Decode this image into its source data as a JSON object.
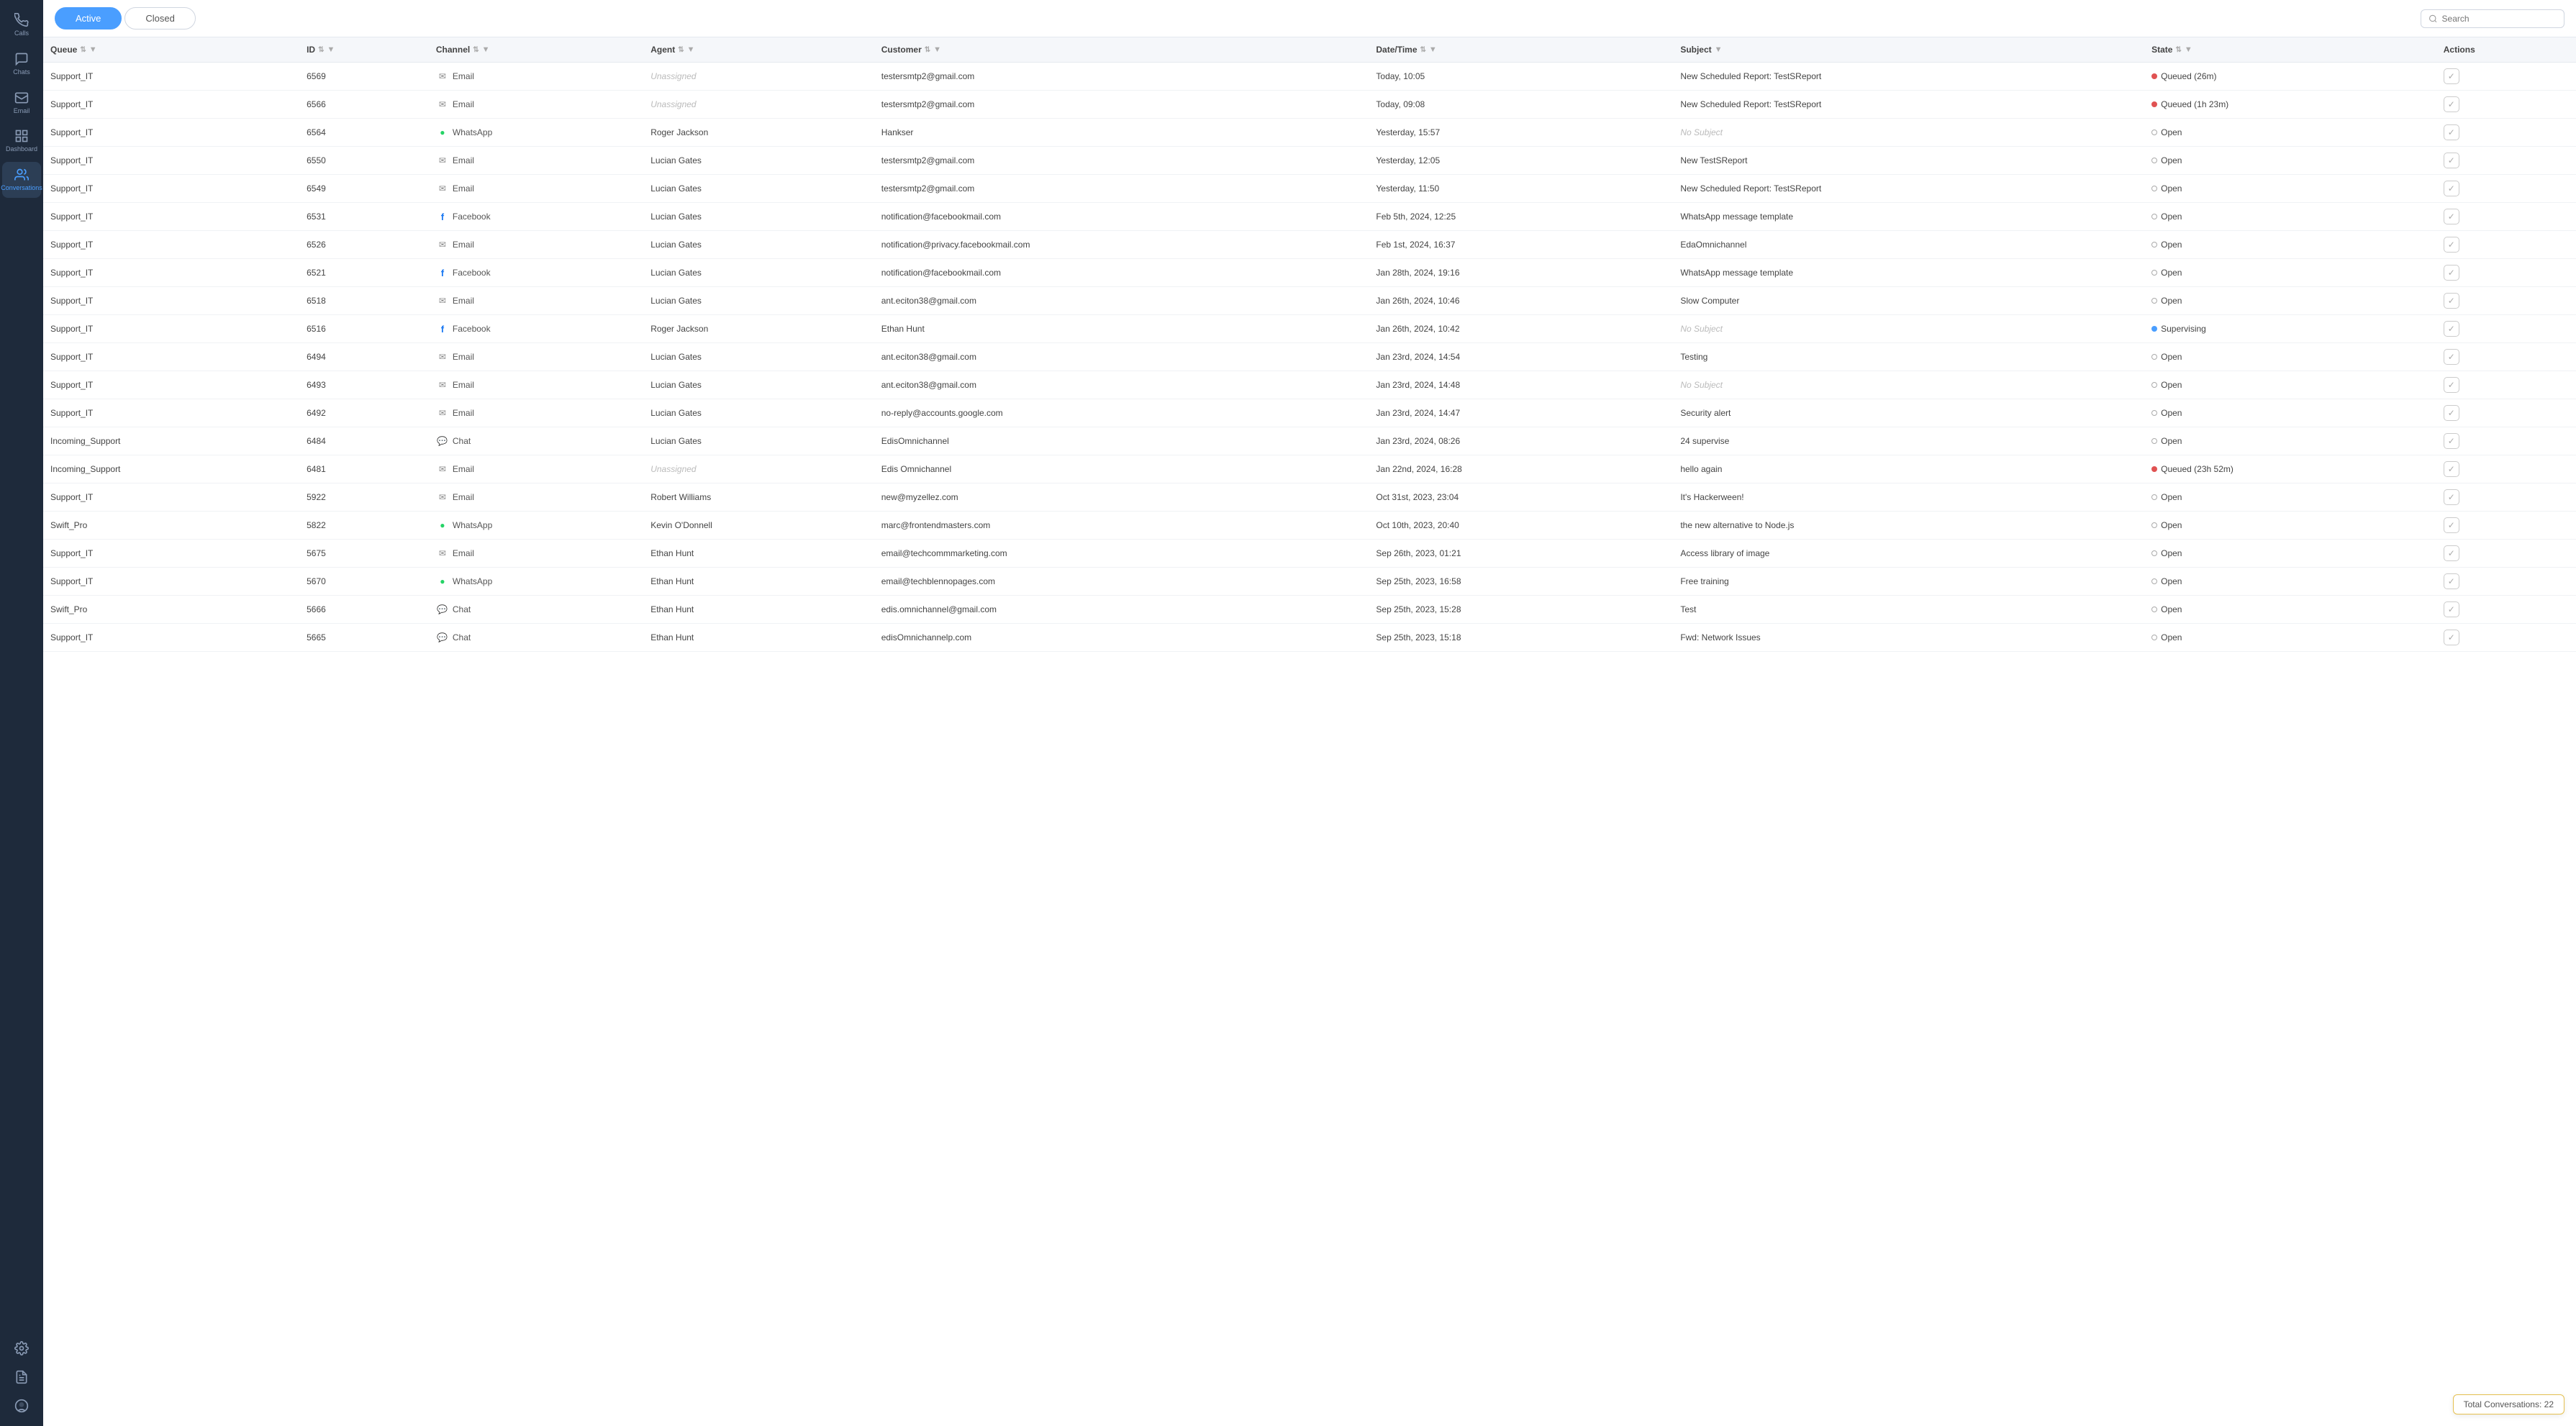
{
  "sidebar": {
    "items": [
      {
        "name": "calls",
        "label": "Calls",
        "icon": "phone"
      },
      {
        "name": "chats",
        "label": "Chats",
        "icon": "chat",
        "active": false
      },
      {
        "name": "email",
        "label": "Email",
        "icon": "mail"
      },
      {
        "name": "dashboard",
        "label": "Dashboard",
        "icon": "grid"
      },
      {
        "name": "conversations",
        "label": "Conversations",
        "icon": "people",
        "active": true
      }
    ],
    "bottom": [
      {
        "name": "settings",
        "label": "",
        "icon": "gear"
      },
      {
        "name": "reports",
        "label": "",
        "icon": "report"
      },
      {
        "name": "profile",
        "label": "",
        "icon": "user-circle"
      }
    ]
  },
  "tabs": {
    "active_label": "Active",
    "closed_label": "Closed"
  },
  "search": {
    "placeholder": "Search"
  },
  "table": {
    "columns": [
      {
        "key": "queue",
        "label": "Queue"
      },
      {
        "key": "id",
        "label": "ID"
      },
      {
        "key": "channel",
        "label": "Channel"
      },
      {
        "key": "agent",
        "label": "Agent"
      },
      {
        "key": "customer",
        "label": "Customer"
      },
      {
        "key": "datetime",
        "label": "Date/Time"
      },
      {
        "key": "subject",
        "label": "Subject"
      },
      {
        "key": "state",
        "label": "State"
      },
      {
        "key": "actions",
        "label": "Actions"
      }
    ],
    "rows": [
      {
        "queue": "Support_IT",
        "id": "6569",
        "channel": "Email",
        "channel_type": "email",
        "agent": "Unassigned",
        "agent_type": "unassigned",
        "customer": "testersmtp2@gmail.com",
        "datetime": "Today, 10:05",
        "subject": "New Scheduled Report: TestSReport",
        "state": "Queued (26m)",
        "state_type": "queued"
      },
      {
        "queue": "Support_IT",
        "id": "6566",
        "channel": "Email",
        "channel_type": "email",
        "agent": "Unassigned",
        "agent_type": "unassigned",
        "customer": "testersmtp2@gmail.com",
        "datetime": "Today, 09:08",
        "subject": "New Scheduled Report: TestSReport",
        "state": "Queued (1h 23m)",
        "state_type": "queued"
      },
      {
        "queue": "Support_IT",
        "id": "6564",
        "channel": "WhatsApp",
        "channel_type": "whatsapp",
        "agent": "Roger Jackson",
        "agent_type": "assigned",
        "customer": "Hankser",
        "datetime": "Yesterday, 15:57",
        "subject": "No Subject",
        "subject_type": "none",
        "state": "Open",
        "state_type": "open"
      },
      {
        "queue": "Support_IT",
        "id": "6550",
        "channel": "Email",
        "channel_type": "email",
        "agent": "Lucian Gates",
        "agent_type": "assigned",
        "customer": "testersmtp2@gmail.com",
        "datetime": "Yesterday, 12:05",
        "subject": "New  TestSReport",
        "state": "Open",
        "state_type": "open"
      },
      {
        "queue": "Support_IT",
        "id": "6549",
        "channel": "Email",
        "channel_type": "email",
        "agent": "Lucian Gates",
        "agent_type": "assigned",
        "customer": "testersmtp2@gmail.com",
        "datetime": "Yesterday, 11:50",
        "subject": "New Scheduled Report: TestSReport",
        "state": "Open",
        "state_type": "open"
      },
      {
        "queue": "Support_IT",
        "id": "6531",
        "channel": "Facebook",
        "channel_type": "facebook",
        "agent": "Lucian Gates",
        "agent_type": "assigned",
        "customer": "notification@facebookmail.com",
        "datetime": "Feb 5th, 2024, 12:25",
        "subject": "WhatsApp message template",
        "state": "Open",
        "state_type": "open"
      },
      {
        "queue": "Support_IT",
        "id": "6526",
        "channel": "Email",
        "channel_type": "email",
        "agent": "Lucian Gates",
        "agent_type": "assigned",
        "customer": "notification@privacy.facebookmail.com",
        "datetime": "Feb 1st, 2024, 16:37",
        "subject": "EdaOmnichannel",
        "state": "Open",
        "state_type": "open"
      },
      {
        "queue": "Support_IT",
        "id": "6521",
        "channel": "Facebook",
        "channel_type": "facebook",
        "agent": "Lucian Gates",
        "agent_type": "assigned",
        "customer": "notification@facebookmail.com",
        "datetime": "Jan 28th, 2024, 19:16",
        "subject": "WhatsApp message template",
        "state": "Open",
        "state_type": "open"
      },
      {
        "queue": "Support_IT",
        "id": "6518",
        "channel": "Email",
        "channel_type": "email",
        "agent": "Lucian Gates",
        "agent_type": "assigned",
        "customer": "ant.eciton38@gmail.com",
        "datetime": "Jan 26th, 2024, 10:46",
        "subject": "Slow Computer",
        "state": "Open",
        "state_type": "open"
      },
      {
        "queue": "Support_IT",
        "id": "6516",
        "channel": "Facebook",
        "channel_type": "facebook",
        "agent": "Roger Jackson",
        "agent_type": "assigned",
        "customer": "Ethan Hunt",
        "datetime": "Jan 26th, 2024, 10:42",
        "subject": "No Subject",
        "subject_type": "none",
        "state": "Supervising",
        "state_type": "supervising"
      },
      {
        "queue": "Support_IT",
        "id": "6494",
        "channel": "Email",
        "channel_type": "email",
        "agent": "Lucian Gates",
        "agent_type": "assigned",
        "customer": "ant.eciton38@gmail.com",
        "datetime": "Jan 23rd, 2024, 14:54",
        "subject": "Testing",
        "state": "Open",
        "state_type": "open"
      },
      {
        "queue": "Support_IT",
        "id": "6493",
        "channel": "Email",
        "channel_type": "email",
        "agent": "Lucian Gates",
        "agent_type": "assigned",
        "customer": "ant.eciton38@gmail.com",
        "datetime": "Jan 23rd, 2024, 14:48",
        "subject": "No Subject",
        "subject_type": "none",
        "state": "Open",
        "state_type": "open"
      },
      {
        "queue": "Support_IT",
        "id": "6492",
        "channel": "Email",
        "channel_type": "email",
        "agent": "Lucian Gates",
        "agent_type": "assigned",
        "customer": "no-reply@accounts.google.com",
        "datetime": "Jan 23rd, 2024, 14:47",
        "subject": "Security alert",
        "state": "Open",
        "state_type": "open"
      },
      {
        "queue": "Incoming_Support",
        "id": "6484",
        "channel": "Chat",
        "channel_type": "chat",
        "agent": "Lucian Gates",
        "agent_type": "assigned",
        "customer": "EdisOmnichannel",
        "datetime": "Jan 23rd, 2024, 08:26",
        "subject": "24 supervise",
        "state": "Open",
        "state_type": "open"
      },
      {
        "queue": "Incoming_Support",
        "id": "6481",
        "channel": "Email",
        "channel_type": "email",
        "agent": "Unassigned",
        "agent_type": "unassigned",
        "customer": "Edis Omnichannel",
        "datetime": "Jan 22nd, 2024, 16:28",
        "subject": "hello again",
        "state": "Queued (23h 52m)",
        "state_type": "queued"
      },
      {
        "queue": "Support_IT",
        "id": "5922",
        "channel": "Email",
        "channel_type": "email",
        "agent": "Robert Williams",
        "agent_type": "assigned",
        "customer": "new@myzellez.com",
        "datetime": "Oct 31st, 2023, 23:04",
        "subject": "It's Hackerween!",
        "state": "Open",
        "state_type": "open"
      },
      {
        "queue": "Swift_Pro",
        "id": "5822",
        "channel": "WhatsApp",
        "channel_type": "whatsapp",
        "agent": "Kevin O'Donnell",
        "agent_type": "assigned",
        "customer": "marc@frontendmasters.com",
        "datetime": "Oct 10th, 2023, 20:40",
        "subject": "the new alternative to Node.js",
        "state": "Open",
        "state_type": "open"
      },
      {
        "queue": "Support_IT",
        "id": "5675",
        "channel": "Email",
        "channel_type": "email",
        "agent": "Ethan Hunt",
        "agent_type": "assigned",
        "customer": "email@techcommmarketing.com",
        "datetime": "Sep 26th, 2023, 01:21",
        "subject": "Access library of image",
        "state": "Open",
        "state_type": "open"
      },
      {
        "queue": "Support_IT",
        "id": "5670",
        "channel": "WhatsApp",
        "channel_type": "whatsapp",
        "agent": "Ethan Hunt",
        "agent_type": "assigned",
        "customer": "email@techblennopages.com",
        "datetime": "Sep 25th, 2023, 16:58",
        "subject": "Free training",
        "state": "Open",
        "state_type": "open"
      },
      {
        "queue": "Swift_Pro",
        "id": "5666",
        "channel": "Chat",
        "channel_type": "chat",
        "agent": "Ethan Hunt",
        "agent_type": "assigned",
        "customer": "edis.omnichannel@gmail.com",
        "datetime": "Sep 25th, 2023, 15:28",
        "subject": "Test",
        "state": "Open",
        "state_type": "open"
      },
      {
        "queue": "Support_IT",
        "id": "5665",
        "channel": "Chat",
        "channel_type": "chat",
        "agent": "Ethan Hunt",
        "agent_type": "assigned",
        "customer": "edisOmnichannelp.com",
        "datetime": "Sep 25th, 2023, 15:18",
        "subject": "Fwd: Network Issues",
        "state": "Open",
        "state_type": "open"
      }
    ]
  },
  "footer": {
    "total_label": "Total Conversations: 22"
  }
}
